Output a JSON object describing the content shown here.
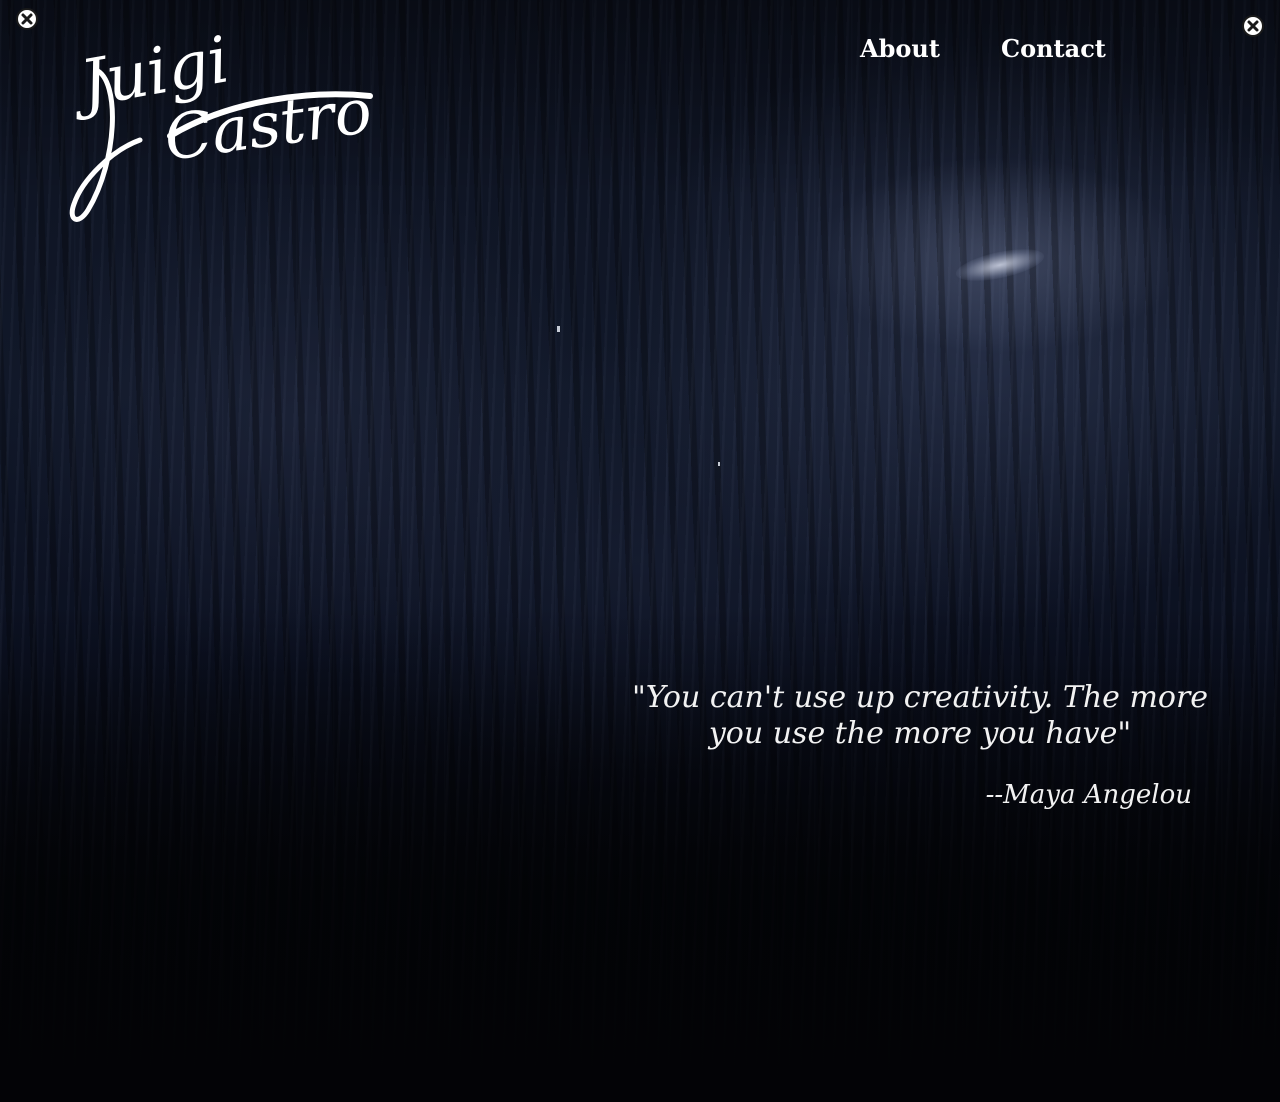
{
  "site": {
    "logo": {
      "first": "Juigi",
      "last": "Castro"
    }
  },
  "nav": {
    "items": [
      {
        "label": "About"
      },
      {
        "label": "Contact"
      }
    ]
  },
  "quote": {
    "text": "\"You can't use up creativity. The more you use the more you have\"",
    "author": "--Maya Angelou"
  },
  "colors": {
    "text": "#ffffff",
    "background": "#0b1020",
    "close_button": "#ffffff"
  },
  "icons": {
    "close_left": "close-icon",
    "close_right": "close-icon"
  }
}
